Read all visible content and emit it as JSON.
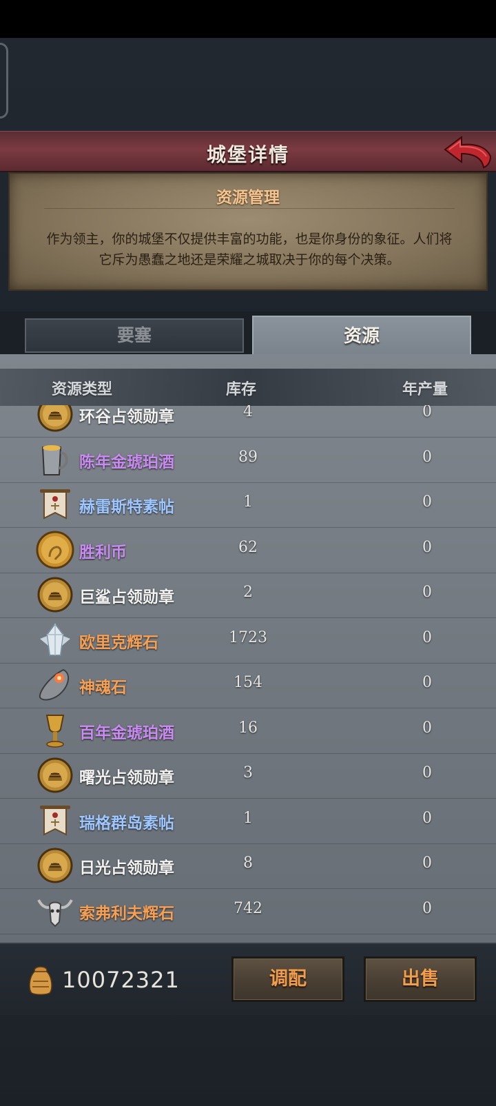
{
  "title": "城堡详情",
  "info": {
    "heading": "资源管理",
    "description_line1": "作为领主，你的城堡不仅提供丰富的功能，也是你身份的象征。人们将",
    "description_line2": "它斥为愚蠢之地还是荣耀之城取决于你的每个决策。"
  },
  "tabs": [
    {
      "label": "要塞",
      "active": false
    },
    {
      "label": "资源",
      "active": true
    }
  ],
  "columns": {
    "type": "资源类型",
    "stock": "库存",
    "yield": "年产量"
  },
  "colors": {
    "white": "#f2f2f2",
    "purple": "#c98bf2",
    "blue": "#9ec6ff",
    "orange": "#f6a056"
  },
  "rows": [
    {
      "icon": "helmet-medal-icon",
      "name": "环谷占领勋章",
      "color": "#f2f2f2",
      "stock": "4",
      "yield": "0"
    },
    {
      "icon": "tankard-icon",
      "name": "陈年金琥珀酒",
      "color": "#c98bf2",
      "stock": "89",
      "yield": "0"
    },
    {
      "icon": "banner-scroll-icon",
      "name": "赫雷斯特素帖",
      "color": "#9ec6ff",
      "stock": "1",
      "yield": "0"
    },
    {
      "icon": "victory-coin-icon",
      "name": "胜利币",
      "color": "#c98bf2",
      "stock": "62",
      "yield": "0"
    },
    {
      "icon": "helmet-medal-icon",
      "name": "巨鲨占领勋章",
      "color": "#f2f2f2",
      "stock": "2",
      "yield": "0"
    },
    {
      "icon": "crystal-icon",
      "name": "欧里克辉石",
      "color": "#f6a056",
      "stock": "1723",
      "yield": "0"
    },
    {
      "icon": "soul-stone-icon",
      "name": "神魂石",
      "color": "#f6a056",
      "stock": "154",
      "yield": "0"
    },
    {
      "icon": "goblet-icon",
      "name": "百年金琥珀酒",
      "color": "#c98bf2",
      "stock": "16",
      "yield": "0"
    },
    {
      "icon": "helmet-medal-icon",
      "name": "曙光占领勋章",
      "color": "#f2f2f2",
      "stock": "3",
      "yield": "0"
    },
    {
      "icon": "banner-scroll-icon",
      "name": "瑞格群岛素帖",
      "color": "#9ec6ff",
      "stock": "1",
      "yield": "0"
    },
    {
      "icon": "helmet-medal-icon",
      "name": "日光占领勋章",
      "color": "#f2f2f2",
      "stock": "8",
      "yield": "0"
    },
    {
      "icon": "horned-skull-icon",
      "name": "索弗利夫辉石",
      "color": "#f6a056",
      "stock": "742",
      "yield": "0"
    }
  ],
  "gold": "10072321",
  "buttons": {
    "allocate": "调配",
    "sell": "出售"
  }
}
